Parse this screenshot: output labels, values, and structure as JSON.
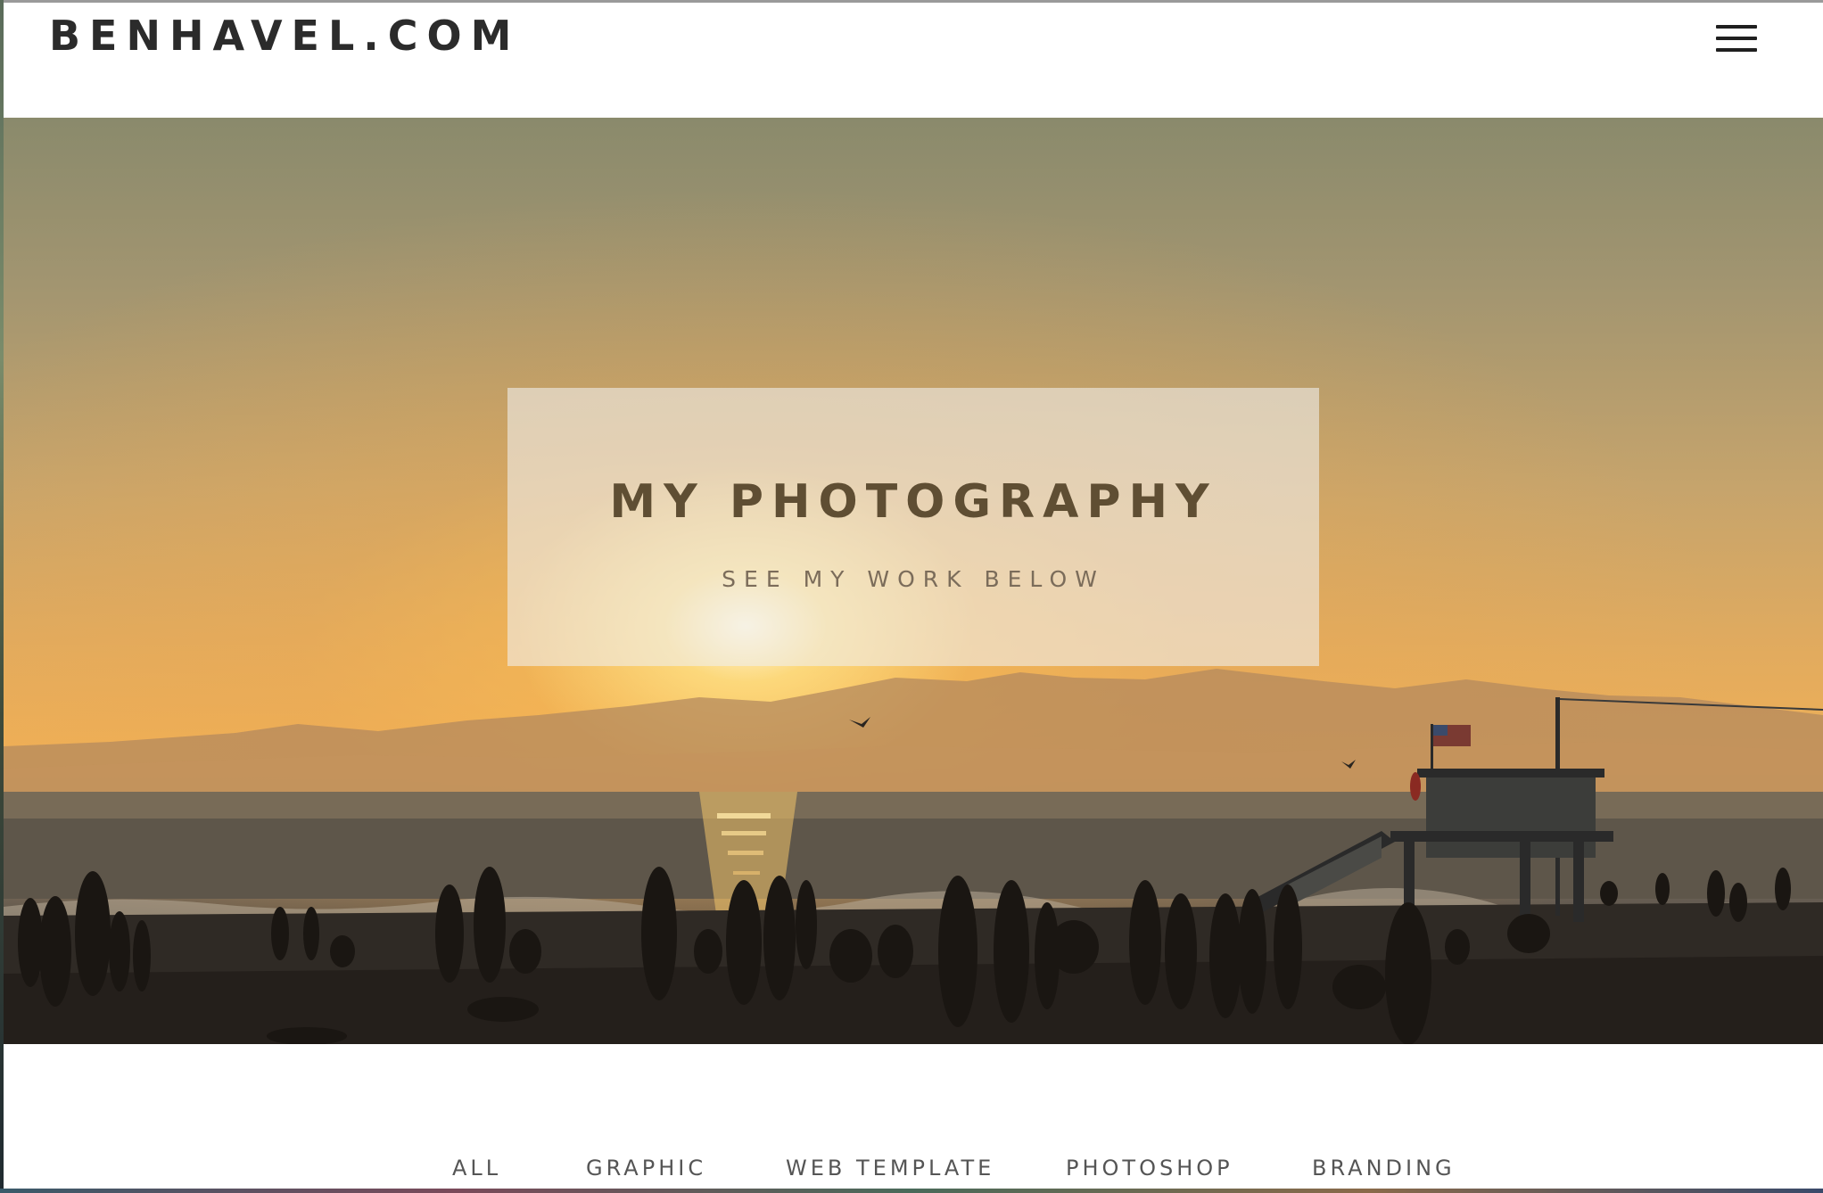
{
  "header": {
    "brand": "BENHAVEL.COM",
    "menu_icon": "hamburger-icon"
  },
  "hero": {
    "title": "MY PHOTOGRAPHY",
    "subtitle": "SEE MY WORK BELOW",
    "image_description": "beach-sunset-photo"
  },
  "filters": {
    "items": [
      {
        "label": "ALL"
      },
      {
        "label": "GRAPHIC"
      },
      {
        "label": "WEB TEMPLATE"
      },
      {
        "label": "PHOTOSHOP"
      },
      {
        "label": "BRANDING"
      }
    ]
  },
  "colors": {
    "brand_text": "#2b2b2b",
    "hero_title": "#5f4e33",
    "hero_subtitle": "#7b6c5a",
    "filter_text": "#555555"
  }
}
